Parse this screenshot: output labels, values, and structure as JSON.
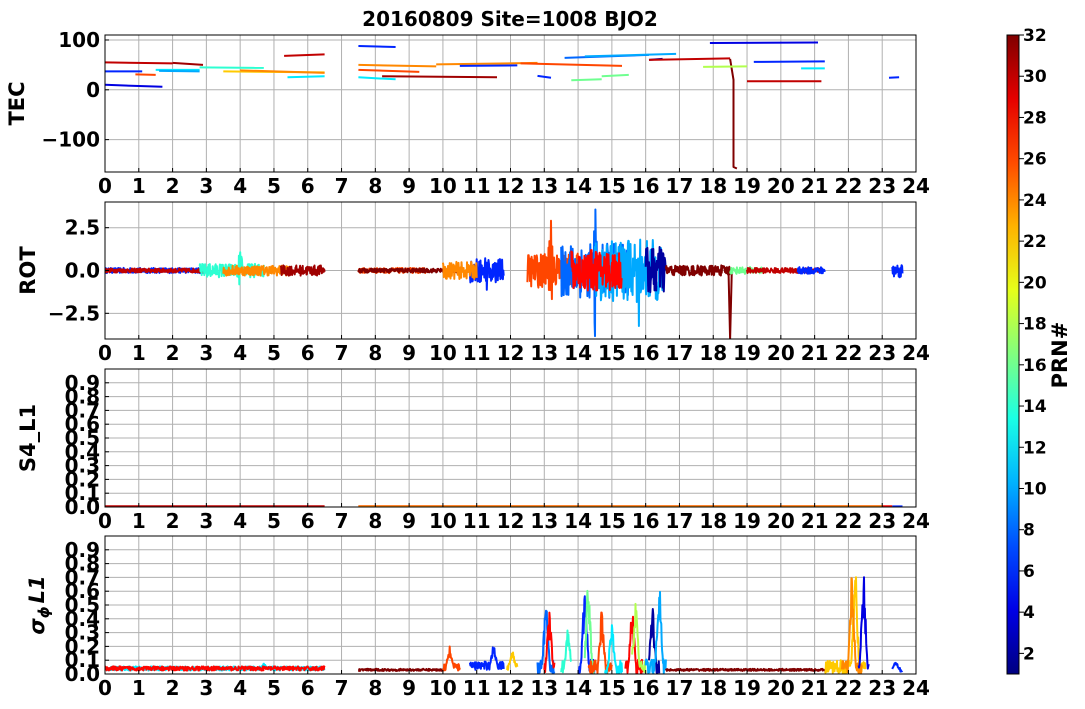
{
  "figure": {
    "title": "20160809 Site=1008 BJO2"
  },
  "chart_data": [
    {
      "type": "line",
      "panel": "TEC",
      "ylabel": "TEC",
      "xlim": [
        0,
        24
      ],
      "ylim": [
        -165,
        110
      ],
      "yticks": [
        100,
        0,
        -100
      ],
      "ytick_labels": [
        "100",
        "0",
        "−100"
      ],
      "xticks": [
        0,
        1,
        2,
        3,
        4,
        5,
        6,
        7,
        8,
        9,
        10,
        11,
        12,
        13,
        14,
        15,
        16,
        17,
        18,
        19,
        20,
        21,
        22,
        23,
        24
      ],
      "grid": true,
      "series": [
        {
          "prn": 4,
          "x": [
            0,
            1.7
          ],
          "y": [
            10,
            6
          ]
        },
        {
          "prn": 6,
          "x": [
            0,
            1.1
          ],
          "y": [
            37,
            37
          ]
        },
        {
          "prn": 30,
          "x": [
            0,
            2
          ],
          "y": [
            55,
            53
          ]
        },
        {
          "prn": 26,
          "x": [
            0.9,
            1.5
          ],
          "y": [
            31,
            30
          ]
        },
        {
          "prn": 12,
          "x": [
            1.5,
            2.8
          ],
          "y": [
            40,
            40
          ]
        },
        {
          "prn": 10,
          "x": [
            1.6,
            2.8
          ],
          "y": [
            38,
            37
          ]
        },
        {
          "prn": 31,
          "x": [
            2,
            2.9
          ],
          "y": [
            54,
            50
          ]
        },
        {
          "prn": 14,
          "x": [
            2.8,
            4.7
          ],
          "y": [
            45,
            44
          ]
        },
        {
          "prn": 22,
          "x": [
            3.5,
            6.5
          ],
          "y": [
            37,
            35
          ]
        },
        {
          "prn": 24,
          "x": [
            4,
            6.5
          ],
          "y": [
            39,
            34
          ]
        },
        {
          "prn": 12,
          "x": [
            5.4,
            6.5
          ],
          "y": [
            25,
            27
          ]
        },
        {
          "prn": 30,
          "x": [
            5.3,
            6.5
          ],
          "y": [
            68,
            71
          ]
        },
        {
          "prn": 6,
          "x": [
            7.5,
            8.6
          ],
          "y": [
            88,
            86
          ]
        },
        {
          "prn": 24,
          "x": [
            7.5,
            9.8
          ],
          "y": [
            50,
            47
          ]
        },
        {
          "prn": 26,
          "x": [
            7.5,
            9.3
          ],
          "y": [
            40,
            36
          ]
        },
        {
          "prn": 12,
          "x": [
            7.5,
            8.6
          ],
          "y": [
            25,
            21
          ]
        },
        {
          "prn": 31,
          "x": [
            8.2,
            11.6
          ],
          "y": [
            27,
            25
          ]
        },
        {
          "prn": 24,
          "x": [
            9.8,
            12.8
          ],
          "y": [
            51,
            54
          ]
        },
        {
          "prn": 6,
          "x": [
            10.5,
            12.2
          ],
          "y": [
            48,
            49
          ]
        },
        {
          "prn": 26,
          "x": [
            12.3,
            15.3
          ],
          "y": [
            53,
            48
          ]
        },
        {
          "prn": 6,
          "x": [
            12.8,
            13.2
          ],
          "y": [
            28,
            24
          ]
        },
        {
          "prn": 16,
          "x": [
            13.8,
            14.7
          ],
          "y": [
            19,
            21
          ]
        },
        {
          "prn": 16,
          "x": [
            14.7,
            15.5
          ],
          "y": [
            27,
            30
          ]
        },
        {
          "prn": 8,
          "x": [
            13.6,
            16.1
          ],
          "y": [
            64,
            70
          ]
        },
        {
          "prn": 10,
          "x": [
            14.2,
            16.9
          ],
          "y": [
            67,
            72
          ]
        },
        {
          "prn": 2,
          "x": [
            16.1,
            16.5
          ],
          "y": [
            60,
            62
          ]
        },
        {
          "prn": 30,
          "x": [
            16.1,
            18.5
          ],
          "y": [
            60,
            63
          ]
        },
        {
          "prn": 32,
          "x": [
            18.5,
            18.6,
            18.6,
            18.7
          ],
          "y": [
            62,
            20,
            -155,
            -158
          ]
        },
        {
          "prn": 18,
          "x": [
            17.7,
            19
          ],
          "y": [
            46,
            47
          ]
        },
        {
          "prn": 4,
          "x": [
            17.9,
            21.1
          ],
          "y": [
            94,
            95
          ]
        },
        {
          "prn": 30,
          "x": [
            19,
            21.2
          ],
          "y": [
            17,
            17
          ]
        },
        {
          "prn": 6,
          "x": [
            19.2,
            21.3
          ],
          "y": [
            56,
            57
          ]
        },
        {
          "prn": 12,
          "x": [
            20.6,
            21.3
          ],
          "y": [
            43,
            43
          ]
        },
        {
          "prn": 6,
          "x": [
            23.2,
            23.5
          ],
          "y": [
            24,
            25
          ]
        }
      ]
    },
    {
      "type": "line",
      "panel": "ROT",
      "ylabel": "ROT",
      "xlim": [
        0,
        24
      ],
      "ylim": [
        -4,
        4
      ],
      "yticks": [
        2.5,
        0,
        -2.5
      ],
      "ytick_labels": [
        "2.5",
        "0.0",
        "−2.5"
      ],
      "xticks": [
        0,
        1,
        2,
        3,
        4,
        5,
        6,
        7,
        8,
        9,
        10,
        11,
        12,
        13,
        14,
        15,
        16,
        17,
        18,
        19,
        20,
        21,
        22,
        23,
        24
      ],
      "grid": true,
      "series": [
        {
          "prn": 6,
          "x": [
            0,
            3
          ],
          "noise": 0.15
        },
        {
          "prn": 30,
          "x": [
            0,
            3
          ],
          "noise": 0.12
        },
        {
          "prn": 14,
          "x": [
            2.8,
            4.7
          ],
          "noise": 0.4,
          "peak": 4,
          "peak_amp": 1.3
        },
        {
          "prn": 24,
          "x": [
            3.5,
            5.5
          ],
          "noise": 0.3
        },
        {
          "prn": 31,
          "x": [
            5.2,
            6.5
          ],
          "noise": 0.3
        },
        {
          "prn": 26,
          "x": [
            7.5,
            9.5
          ],
          "noise": 0.15
        },
        {
          "prn": 32,
          "x": [
            7.5,
            10.5
          ],
          "noise": 0.12
        },
        {
          "prn": 6,
          "x": [
            10.8,
            11.8
          ],
          "noise": 0.7,
          "peak": 11.3,
          "peak_amp": 1.5
        },
        {
          "prn": 24,
          "x": [
            10,
            11
          ],
          "noise": 0.5
        },
        {
          "prn": 26,
          "x": [
            12.5,
            14
          ],
          "noise": 1.0,
          "peak": 13.2,
          "peak_amp": 3.8
        },
        {
          "prn": 8,
          "x": [
            13.5,
            15.5
          ],
          "noise": 1.6,
          "peak": 14.5,
          "peak_amp": 4.0
        },
        {
          "prn": 10,
          "x": [
            14.5,
            16.5
          ],
          "noise": 1.8,
          "peak": 15.8,
          "peak_amp": 4.0
        },
        {
          "prn": 28,
          "x": [
            13.8,
            15.3
          ],
          "noise": 1.2
        },
        {
          "prn": 2,
          "x": [
            16,
            16.6
          ],
          "noise": 1.4
        },
        {
          "prn": 32,
          "x": [
            16.6,
            18.5
          ],
          "noise": 0.3
        },
        {
          "prn": 32,
          "x": [
            18.45,
            18.5,
            18.55
          ],
          "y": [
            0,
            -4,
            0
          ]
        },
        {
          "prn": 16,
          "x": [
            18.5,
            19.5
          ],
          "noise": 0.2
        },
        {
          "prn": 30,
          "x": [
            19,
            21.2
          ],
          "noise": 0.15
        },
        {
          "prn": 6,
          "x": [
            20.5,
            21.3
          ],
          "noise": 0.2
        },
        {
          "prn": 6,
          "x": [
            23.3,
            23.6
          ],
          "noise": 0.4
        }
      ]
    },
    {
      "type": "line",
      "panel": "S4_L1",
      "ylabel": "S4_L1",
      "xlim": [
        0,
        24
      ],
      "ylim": [
        0,
        1.0
      ],
      "yticks": [
        0.0,
        0.1,
        0.2,
        0.3,
        0.4,
        0.5,
        0.6,
        0.7,
        0.8,
        0.9
      ],
      "ytick_labels": [
        "0.0",
        "0.1",
        "0.2",
        "0.3",
        "0.4",
        "0.5",
        "0.6",
        "0.7",
        "0.8",
        "0.9"
      ],
      "xticks": [
        0,
        1,
        2,
        3,
        4,
        5,
        6,
        7,
        8,
        9,
        10,
        11,
        12,
        13,
        14,
        15,
        16,
        17,
        18,
        19,
        20,
        21,
        22,
        23,
        24
      ],
      "grid": true,
      "series": [
        {
          "prn": 30,
          "x": [
            0,
            6.5
          ],
          "y": [
            0.005,
            0.005
          ]
        },
        {
          "prn": 28,
          "x": [
            7.5,
            23.3
          ],
          "y": [
            0.006,
            0.006
          ]
        },
        {
          "prn": 24,
          "x": [
            7.5,
            23.0
          ],
          "y": [
            0.004,
            0.004
          ]
        },
        {
          "prn": 6,
          "x": [
            23.3,
            23.6
          ],
          "y": [
            0.004,
            0.004
          ]
        }
      ]
    },
    {
      "type": "line",
      "panel": "sigma_phi_L1",
      "ylabel_main": "σ",
      "ylabel_sub": "ϕ",
      "ylabel_tail": "L1",
      "xlim": [
        0,
        24
      ],
      "ylim": [
        0,
        1.0
      ],
      "yticks": [
        0.0,
        0.1,
        0.2,
        0.3,
        0.4,
        0.5,
        0.6,
        0.7,
        0.8,
        0.9
      ],
      "ytick_labels": [
        "0.0",
        "0.1",
        "0.2",
        "0.3",
        "0.4",
        "0.5",
        "0.6",
        "0.7",
        "0.8",
        "0.9"
      ],
      "xticks": [
        0,
        1,
        2,
        3,
        4,
        5,
        6,
        7,
        8,
        9,
        10,
        11,
        12,
        13,
        14,
        15,
        16,
        17,
        18,
        19,
        20,
        21,
        22,
        23,
        24
      ],
      "grid": true,
      "series": [
        {
          "prn": 12,
          "x": [
            0,
            6.5
          ],
          "base": 0.04,
          "noise": 0.03,
          "peak": 4.7,
          "peak_amp": 0.08
        },
        {
          "prn": 28,
          "x": [
            0,
            6.5
          ],
          "base": 0.04,
          "noise": 0.03
        },
        {
          "prn": 32,
          "x": [
            7.5,
            10
          ],
          "base": 0.03,
          "noise": 0.015
        },
        {
          "prn": 26,
          "x": [
            10,
            10.5
          ],
          "base": 0.05,
          "noise": 0.05,
          "peak": 10.2,
          "peak_amp": 0.22
        },
        {
          "prn": 6,
          "x": [
            10.8,
            11.8
          ],
          "base": 0.06,
          "noise": 0.06,
          "peak": 11.5,
          "peak_amp": 0.23
        },
        {
          "prn": 22,
          "x": [
            11.9,
            12.2
          ],
          "base": 0.05,
          "noise": 0.05,
          "peak": 12.05,
          "peak_amp": 0.19
        },
        {
          "prn": 8,
          "x": [
            12.8,
            13.3
          ],
          "base": 0.05,
          "noise": 0.1,
          "peak": 13.05,
          "peak_amp": 0.62
        },
        {
          "prn": 28,
          "x": [
            13,
            13.3
          ],
          "base": 0.05,
          "noise": 0.08,
          "peak": 13.15,
          "peak_amp": 0.48
        },
        {
          "prn": 14,
          "x": [
            13.5,
            13.8
          ],
          "base": 0.05,
          "noise": 0.1,
          "peak": 13.7,
          "peak_amp": 0.35
        },
        {
          "prn": 6,
          "x": [
            14,
            14.5
          ],
          "base": 0.05,
          "noise": 0.15,
          "peak": 14.2,
          "peak_amp": 0.76
        },
        {
          "prn": 16,
          "x": [
            14.2,
            14.5
          ],
          "base": 0.05,
          "noise": 0.1,
          "peak": 14.3,
          "peak_amp": 0.76
        },
        {
          "prn": 26,
          "x": [
            14.3,
            15
          ],
          "base": 0.05,
          "noise": 0.1,
          "peak": 14.7,
          "peak_amp": 0.5
        },
        {
          "prn": 12,
          "x": [
            14.8,
            15.3
          ],
          "base": 0.05,
          "noise": 0.1,
          "peak": 15,
          "peak_amp": 0.4
        },
        {
          "prn": 28,
          "x": [
            15.4,
            15.9
          ],
          "base": 0.05,
          "noise": 0.12,
          "peak": 15.6,
          "peak_amp": 0.52
        },
        {
          "prn": 18,
          "x": [
            15.6,
            16
          ],
          "base": 0.05,
          "noise": 0.1,
          "peak": 15.7,
          "peak_amp": 0.6
        },
        {
          "prn": 2,
          "x": [
            16.1,
            16.4
          ],
          "base": 0.05,
          "noise": 0.1,
          "peak": 16.2,
          "peak_amp": 0.53
        },
        {
          "prn": 10,
          "x": [
            16,
            16.6
          ],
          "base": 0.05,
          "noise": 0.12,
          "peak": 16.4,
          "peak_amp": 0.76
        },
        {
          "prn": 32,
          "x": [
            16.6,
            21.3
          ],
          "base": 0.03,
          "noise": 0.015
        },
        {
          "prn": 22,
          "x": [
            21.3,
            22.5
          ],
          "base": 0.05,
          "noise": 0.1,
          "peak": 22.2,
          "peak_amp": 0.9
        },
        {
          "prn": 24,
          "x": [
            21.8,
            22.4
          ],
          "base": 0.05,
          "noise": 0.1,
          "peak": 22.1,
          "peak_amp": 0.78
        },
        {
          "prn": 4,
          "x": [
            22.3,
            22.6
          ],
          "base": 0.05,
          "noise": 0.05,
          "peak": 22.45,
          "peak_amp": 0.79
        },
        {
          "prn": 6,
          "x": [
            23.3,
            23.6
          ],
          "base": 0.03,
          "noise": 0.03,
          "peak": 23.4,
          "peak_amp": 0.1
        }
      ]
    }
  ],
  "colorbar": {
    "label": "PRN#",
    "range": [
      1,
      32
    ],
    "ticks": [
      2,
      4,
      6,
      8,
      10,
      12,
      14,
      16,
      18,
      20,
      22,
      24,
      26,
      28,
      30,
      32
    ],
    "tick_labels": [
      "2",
      "4",
      "6",
      "8",
      "10",
      "12",
      "14",
      "16",
      "18",
      "20",
      "22",
      "24",
      "26",
      "28",
      "30",
      "32"
    ],
    "colormap": "jet"
  }
}
